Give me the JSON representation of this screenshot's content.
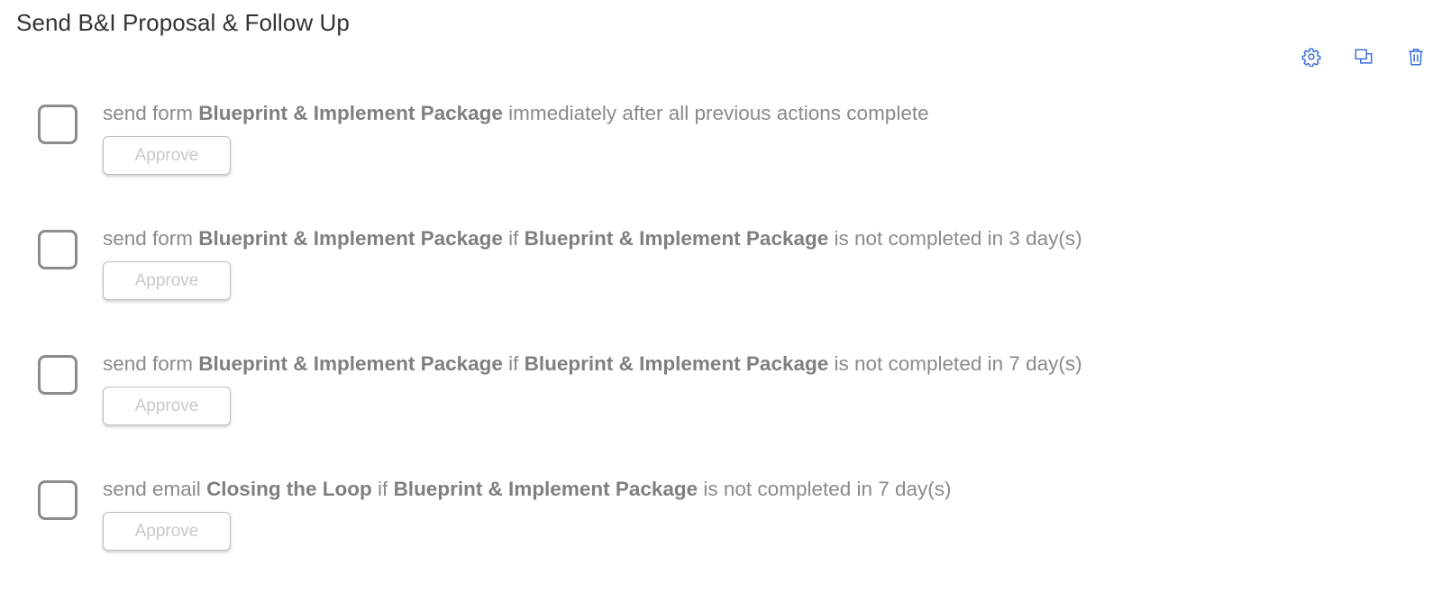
{
  "page": {
    "title": "Send B&I Proposal & Follow Up"
  },
  "toolbar": {
    "icons": [
      "gear-icon",
      "duplicate-icon",
      "trash-icon"
    ],
    "accent": "#3a6fd8"
  },
  "actions": [
    {
      "segments": [
        {
          "text": "send form ",
          "bold": false
        },
        {
          "text": "Blueprint & Implement Package",
          "bold": true
        },
        {
          "text": " immediately after all previous actions complete",
          "bold": false
        }
      ],
      "button_label": "Approve"
    },
    {
      "segments": [
        {
          "text": "send form ",
          "bold": false
        },
        {
          "text": "Blueprint & Implement Package",
          "bold": true
        },
        {
          "text": " if ",
          "bold": false
        },
        {
          "text": "Blueprint & Implement Package",
          "bold": true
        },
        {
          "text": " is not completed in 3 day(s)",
          "bold": false
        }
      ],
      "button_label": "Approve"
    },
    {
      "segments": [
        {
          "text": "send form ",
          "bold": false
        },
        {
          "text": "Blueprint & Implement Package",
          "bold": true
        },
        {
          "text": " if ",
          "bold": false
        },
        {
          "text": "Blueprint & Implement Package",
          "bold": true
        },
        {
          "text": " is not completed in 7 day(s)",
          "bold": false
        }
      ],
      "button_label": "Approve"
    },
    {
      "segments": [
        {
          "text": "send email ",
          "bold": false
        },
        {
          "text": "Closing the Loop",
          "bold": true
        },
        {
          "text": " if ",
          "bold": false
        },
        {
          "text": "Blueprint & Implement Package",
          "bold": true
        },
        {
          "text": " is not completed in 7 day(s)",
          "bold": false
        }
      ],
      "button_label": "Approve"
    }
  ]
}
